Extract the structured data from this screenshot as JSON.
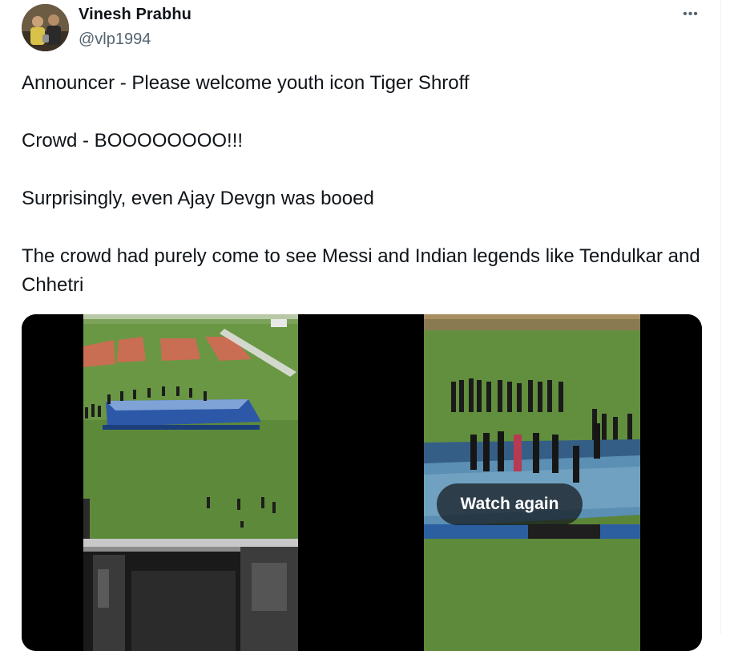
{
  "author": {
    "display_name": "Vinesh Prabhu",
    "handle": "@vlp1994",
    "avatar_icon": "profile-photo"
  },
  "menu": {
    "more_icon": "more-horizontal-icon",
    "more_glyph": "•••"
  },
  "tweet": {
    "lines": [
      "Announcer - Please welcome youth icon Tiger Shroff",
      "Crowd - BOOOOOOOO!!!",
      "Surprisingly, even Ajay Devgn was booed",
      "The crowd had purely come to see Messi and Indian legends like Tendulkar and Chhetri"
    ]
  },
  "media": {
    "count": 2,
    "watch_again_label": "Watch again"
  },
  "colors": {
    "text": "#0f1419",
    "secondary": "#536471",
    "pitch_green": "#5f8a3c",
    "stage_blue": "#2f6cb8"
  }
}
